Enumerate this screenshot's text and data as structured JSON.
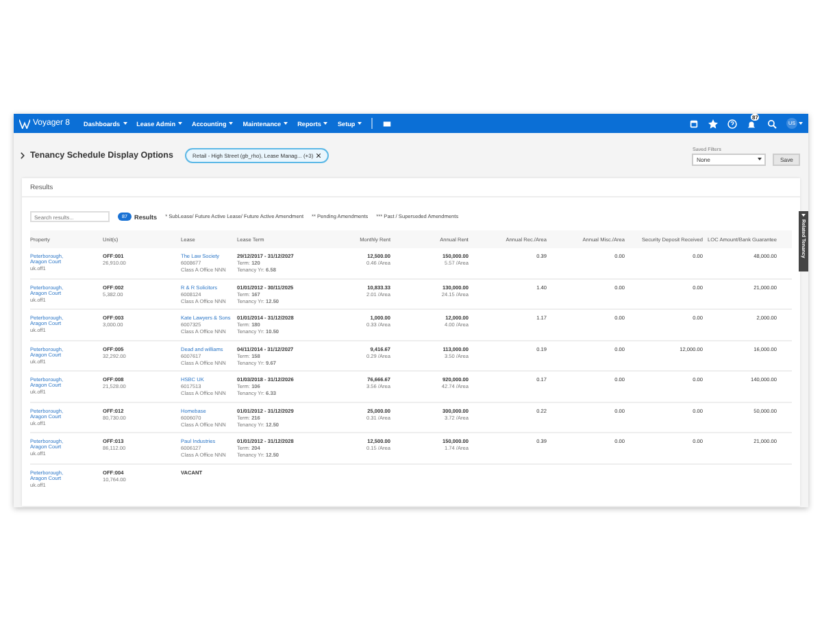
{
  "navbar": {
    "logo": "Voyager 8",
    "menus": [
      {
        "label": "Dashboards"
      },
      {
        "label": "Lease Admin"
      },
      {
        "label": "Accounting"
      },
      {
        "label": "Maintenance"
      },
      {
        "label": "Reports"
      },
      {
        "label": "Setup"
      }
    ],
    "notification_count": "87",
    "avatar": "US"
  },
  "options": {
    "title": "Tenancy Schedule Display Options",
    "expanded": false,
    "filter_chip": "Retail - High Street (gb_rho), Lease Manag... (+3)",
    "saved_filters_label": "Saved Filters",
    "saved_filter": "None",
    "save_button": "Save"
  },
  "results": {
    "title": "Results",
    "search": {
      "placeholder": "Search results..."
    },
    "count": "87",
    "count_label": "Results",
    "legend": [
      "* SubLease/ Future Active Lease/ Future Active Amendment",
      "** Pending Amendments",
      "*** Past / Superseded Amendments"
    ],
    "side_tab": "Related Tenancy",
    "columns": [
      "Property",
      "Unit(s)",
      "Lease",
      "Lease Term",
      "Monthly Rent",
      "Annual Rent",
      "Annual Rec./Area",
      "Annual Misc./Area",
      "Security Deposit Received",
      "LOC Amount/Bank Guarantee"
    ],
    "rows": [
      {
        "kind": "lease",
        "property": "Peterborough, Aragon Court",
        "property_code": "uk.off1",
        "unit": "OFF:001",
        "unit_area": "26,910.00",
        "lease": "The Law Society",
        "lease_id": "6008677",
        "lease_class": "Class A Office NNN",
        "term_dates": "29/12/2017 - 31/12/2027",
        "term_label": "Term:",
        "term": "120",
        "tenancy_label": "Tenancy Yr:",
        "tenancy_yr": "6.58",
        "monthly_rent": "12,500.00",
        "monthly_area": "0.46 /Area",
        "annual_rent": "150,000.00",
        "annual_area": "5.57 /Area",
        "rec": "0.39",
        "misc": "0.00",
        "deposit": "0.00",
        "loc": "48,000.00"
      },
      {
        "kind": "lease",
        "property": "Peterborough, Aragon Court",
        "property_code": "uk.off1",
        "unit": "OFF:002",
        "unit_area": "5,382.00",
        "lease": "R & R Solicitors",
        "lease_id": "6008124",
        "lease_class": "Class A Office NNN",
        "term_dates": "01/01/2012 - 30/11/2025",
        "term_label": "Term:",
        "term": "167",
        "tenancy_label": "Tenancy Yr:",
        "tenancy_yr": "12.50",
        "monthly_rent": "10,833.33",
        "monthly_area": "2.01 /Area",
        "annual_rent": "130,000.00",
        "annual_area": "24.15 /Area",
        "rec": "1.40",
        "misc": "0.00",
        "deposit": "0.00",
        "loc": "21,000.00"
      },
      {
        "kind": "lease",
        "property": "Peterborough, Aragon Court",
        "property_code": "uk.off1",
        "unit": "OFF:003",
        "unit_area": "3,000.00",
        "lease": "Kate Lawyers & Sons",
        "lease_id": "6007325",
        "lease_class": "Class A Office NNN",
        "term_dates": "01/01/2014 - 31/12/2028",
        "term_label": "Term:",
        "term": "180",
        "tenancy_label": "Tenancy Yr:",
        "tenancy_yr": "10.50",
        "monthly_rent": "1,000.00",
        "monthly_area": "0.33 /Area",
        "annual_rent": "12,000.00",
        "annual_area": "4.00 /Area",
        "rec": "1.17",
        "misc": "0.00",
        "deposit": "0.00",
        "loc": "2,000.00"
      },
      {
        "kind": "lease",
        "property": "Peterborough, Aragon Court",
        "property_code": "uk.off1",
        "unit": "OFF:005",
        "unit_area": "32,292.00",
        "lease": "Dead and williams",
        "lease_id": "6007617",
        "lease_class": "Class A Office NNN",
        "term_dates": "04/11/2014 - 31/12/2027",
        "term_label": "Term:",
        "term": "158",
        "tenancy_label": "Tenancy Yr:",
        "tenancy_yr": "9.67",
        "monthly_rent": "9,416.67",
        "monthly_area": "0.29 /Area",
        "annual_rent": "113,000.00",
        "annual_area": "3.50 /Area",
        "rec": "0.19",
        "misc": "0.00",
        "deposit": "12,000.00",
        "loc": "16,000.00"
      },
      {
        "kind": "lease",
        "property": "Peterborough, Aragon Court",
        "property_code": "uk.off1",
        "unit": "OFF:008",
        "unit_area": "21,528.00",
        "lease": "HSBC UK",
        "lease_id": "6017513",
        "lease_class": "Class A Office NNN",
        "term_dates": "01/03/2018 - 31/12/2026",
        "term_label": "Term:",
        "term": "106",
        "tenancy_label": "Tenancy Yr:",
        "tenancy_yr": "6.33",
        "monthly_rent": "76,666.67",
        "monthly_area": "3.56 /Area",
        "annual_rent": "920,000.00",
        "annual_area": "42.74 /Area",
        "rec": "0.17",
        "misc": "0.00",
        "deposit": "0.00",
        "loc": "140,000.00"
      },
      {
        "kind": "lease",
        "property": "Peterborough, Aragon Court",
        "property_code": "uk.off1",
        "unit": "OFF:012",
        "unit_area": "80,730.00",
        "lease": "Homebase",
        "lease_id": "6006070",
        "lease_class": "Class A Office NNN",
        "term_dates": "01/01/2012 - 31/12/2029",
        "term_label": "Term:",
        "term": "216",
        "tenancy_label": "Tenancy Yr:",
        "tenancy_yr": "12.50",
        "monthly_rent": "25,000.00",
        "monthly_area": "0.31 /Area",
        "annual_rent": "300,000.00",
        "annual_area": "3.72 /Area",
        "rec": "0.22",
        "misc": "0.00",
        "deposit": "0.00",
        "loc": "50,000.00"
      },
      {
        "kind": "lease",
        "property": "Peterborough, Aragon Court",
        "property_code": "uk.off1",
        "unit": "OFF:013",
        "unit_area": "86,112.00",
        "lease": "Paul Industries",
        "lease_id": "6006127",
        "lease_class": "Class A Office NNN",
        "term_dates": "01/01/2012 - 31/12/2028",
        "term_label": "Term:",
        "term": "204",
        "tenancy_label": "Tenancy Yr:",
        "tenancy_yr": "12.50",
        "monthly_rent": "12,500.00",
        "monthly_area": "0.15 /Area",
        "annual_rent": "150,000.00",
        "annual_area": "1.74 /Area",
        "rec": "0.39",
        "misc": "0.00",
        "deposit": "0.00",
        "loc": "21,000.00"
      },
      {
        "kind": "vacant",
        "property": "Peterborough, Aragon Court",
        "property_code": "uk.off1",
        "unit": "OFF:004",
        "unit_area": "10,764.00",
        "status": "VACANT"
      }
    ]
  }
}
